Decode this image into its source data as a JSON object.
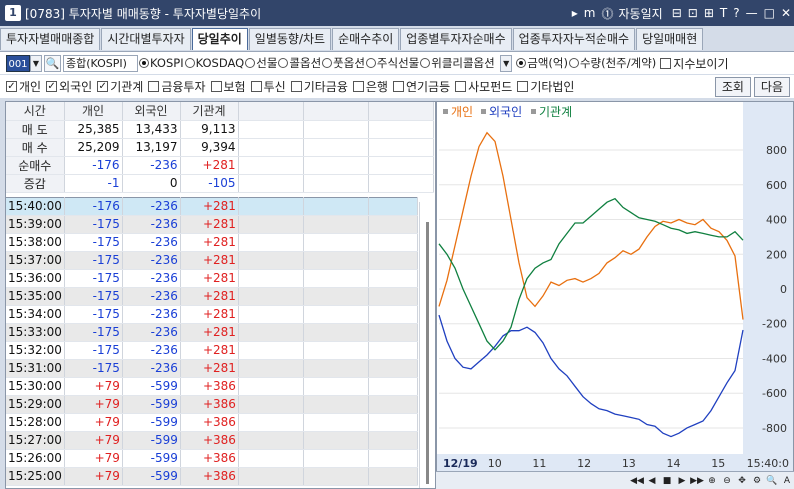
{
  "window": {
    "number": "1",
    "title": "[0783] 투자자별 매매동향 - 투자자별당일추이",
    "autolock": "자동일지",
    "buttons": [
      "▸",
      "m",
      "⓵",
      "⊟",
      "⊡",
      "⊞",
      "T",
      "?",
      "—",
      "□",
      "✕"
    ]
  },
  "tabs": [
    "투자자별매매종합",
    "시간대별투자자",
    "당일추이",
    "일별동향/차트",
    "순매수추이",
    "업종별투자자순매수",
    "업종투자자누적순매수",
    "당일매매현"
  ],
  "active_tab": 2,
  "options": {
    "code": "001",
    "market": "종합(KOSPI)",
    "markets": [
      "KOSPI",
      "KOSDAQ",
      "선물",
      "콜옵션",
      "풋옵션",
      "주식선물",
      "위클리콜옵션"
    ],
    "market_selected": 0,
    "units": [
      "금액(억)",
      "수량(천주/계약)"
    ],
    "unit_selected": 0,
    "index_view": "지수보이기"
  },
  "categories": [
    {
      "label": "개인",
      "checked": true
    },
    {
      "label": "외국인",
      "checked": true
    },
    {
      "label": "기관계",
      "checked": true
    },
    {
      "label": "금융투자",
      "checked": false
    },
    {
      "label": "보험",
      "checked": false
    },
    {
      "label": "투신",
      "checked": false
    },
    {
      "label": "기타금융",
      "checked": false
    },
    {
      "label": "은행",
      "checked": false
    },
    {
      "label": "연기금등",
      "checked": false
    },
    {
      "label": "사모펀드",
      "checked": false
    },
    {
      "label": "기타법인",
      "checked": false
    }
  ],
  "buttons": {
    "query": "조회",
    "next": "다음"
  },
  "summary": {
    "headers": [
      "시간",
      "개인",
      "외국인",
      "기관계"
    ],
    "rows": [
      {
        "label": "매 도",
        "values": [
          "25,385",
          "13,433",
          "9,113"
        ]
      },
      {
        "label": "매 수",
        "values": [
          "25,209",
          "13,197",
          "9,394"
        ]
      },
      {
        "label": "순매수",
        "values": [
          "-176",
          "-236",
          "+281"
        ]
      },
      {
        "label": "증감",
        "values": [
          "-1",
          "0",
          "-105"
        ]
      }
    ]
  },
  "timeline": [
    [
      "15:40:00",
      "-176",
      "-236",
      "+281"
    ],
    [
      "15:39:00",
      "-175",
      "-236",
      "+281"
    ],
    [
      "15:38:00",
      "-175",
      "-236",
      "+281"
    ],
    [
      "15:37:00",
      "-175",
      "-236",
      "+281"
    ],
    [
      "15:36:00",
      "-175",
      "-236",
      "+281"
    ],
    [
      "15:35:00",
      "-175",
      "-236",
      "+281"
    ],
    [
      "15:34:00",
      "-175",
      "-236",
      "+281"
    ],
    [
      "15:33:00",
      "-175",
      "-236",
      "+281"
    ],
    [
      "15:32:00",
      "-175",
      "-236",
      "+281"
    ],
    [
      "15:31:00",
      "-175",
      "-236",
      "+281"
    ],
    [
      "15:30:00",
      "+79",
      "-599",
      "+386"
    ],
    [
      "15:29:00",
      "+79",
      "-599",
      "+386"
    ],
    [
      "15:28:00",
      "+79",
      "-599",
      "+386"
    ],
    [
      "15:27:00",
      "+79",
      "-599",
      "+386"
    ],
    [
      "15:26:00",
      "+79",
      "-599",
      "+386"
    ],
    [
      "15:25:00",
      "+79",
      "-599",
      "+386"
    ]
  ],
  "chart_data": {
    "type": "line",
    "legend": [
      "개인",
      "외국인",
      "기관계"
    ],
    "colors": {
      "개인": "#e87010",
      "외국인": "#2040c0",
      "기관계": "#108040"
    },
    "yticks": [
      800,
      600,
      400,
      200,
      0,
      -200,
      -400,
      -600,
      -800
    ],
    "ylim": [
      -950,
      950
    ],
    "xticks": [
      "12/19",
      "10",
      "11",
      "12",
      "13",
      "14",
      "15",
      "15:40:0"
    ],
    "series": [
      {
        "name": "개인",
        "values": [
          -100,
          50,
          250,
          450,
          650,
          820,
          900,
          850,
          650,
          400,
          150,
          -50,
          -100,
          -40,
          40,
          20,
          50,
          60,
          40,
          60,
          90,
          150,
          180,
          220,
          200,
          230,
          300,
          360,
          390,
          380,
          400,
          380,
          370,
          400,
          350,
          330,
          280,
          190,
          -176
        ]
      },
      {
        "name": "외국인",
        "values": [
          -150,
          -300,
          -400,
          -450,
          -460,
          -420,
          -380,
          -330,
          -270,
          -240,
          -240,
          -220,
          -250,
          -310,
          -400,
          -460,
          -500,
          -560,
          -620,
          -660,
          -690,
          -700,
          -720,
          -730,
          -740,
          -750,
          -780,
          -790,
          -830,
          -850,
          -830,
          -800,
          -780,
          -760,
          -700,
          -620,
          -540,
          -470,
          -236
        ]
      },
      {
        "name": "기관계",
        "values": [
          260,
          200,
          120,
          0,
          -100,
          -200,
          -300,
          -350,
          -300,
          -220,
          -60,
          60,
          120,
          150,
          170,
          260,
          320,
          380,
          380,
          420,
          460,
          500,
          520,
          470,
          440,
          410,
          400,
          390,
          370,
          350,
          340,
          320,
          330,
          320,
          310,
          300,
          300,
          330,
          281
        ]
      }
    ]
  }
}
